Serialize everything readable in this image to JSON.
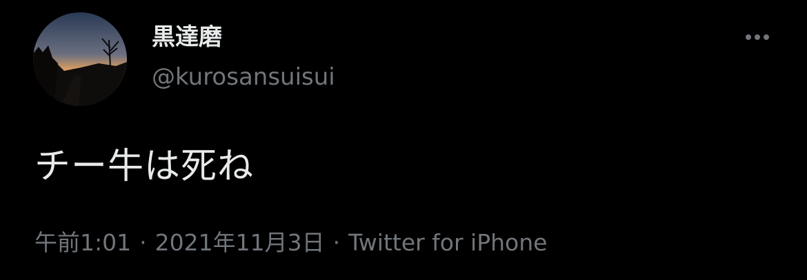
{
  "tweet": {
    "author": {
      "display_name": "黒達磨",
      "handle": "@kurosansuisui",
      "avatar": "sunset-silhouette-photo"
    },
    "more_icon": "more-horizontal-icon",
    "text": "チー牛は死ね",
    "meta": {
      "time": "午前1:01",
      "separator": "·",
      "date": "2021年11月3日",
      "source": "Twitter for iPhone"
    }
  },
  "colors": {
    "background": "#000000",
    "primary_text": "#e7e9ea",
    "secondary_text": "#71767b"
  }
}
